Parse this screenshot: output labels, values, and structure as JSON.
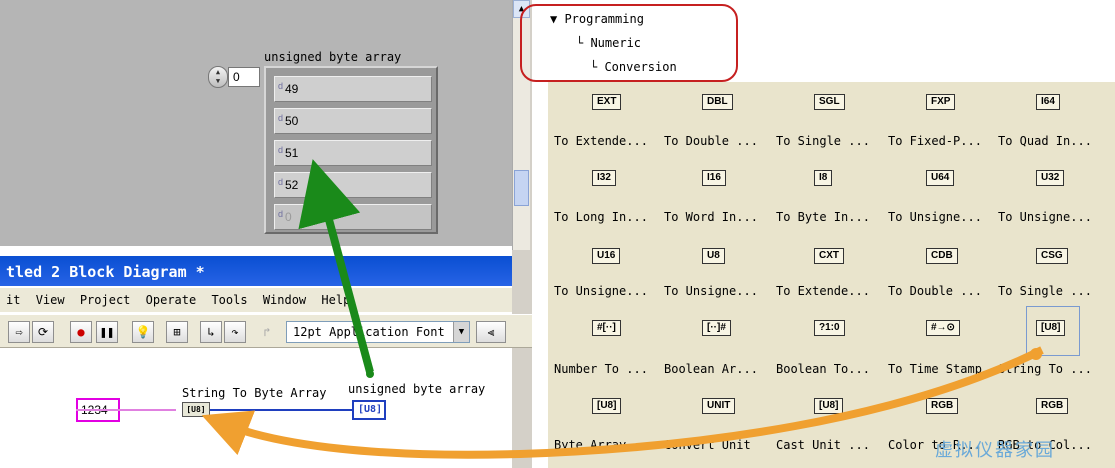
{
  "front_panel": {
    "array_label": "unsigned byte array",
    "index_value": "0",
    "radix": "d",
    "elements": [
      "49",
      "50",
      "51",
      "52",
      "0"
    ]
  },
  "block_diagram": {
    "window_title": "tled 2 Block Diagram *",
    "menu": [
      "it",
      "View",
      "Project",
      "Operate",
      "Tools",
      "Window",
      "Help"
    ],
    "font_selector": "12pt Application Font",
    "string_constant": "1234",
    "function_label": "String To Byte Array",
    "function_icon": "[U8]",
    "indicator_label": "unsigned byte array",
    "indicator_icon": "[U8]"
  },
  "palette": {
    "path": [
      "Programming",
      "Numeric",
      "Conversion"
    ],
    "rows": [
      {
        "icons": [
          "EXT",
          "DBL",
          "SGL",
          "FXP",
          "I64"
        ],
        "labels": [
          "To Extende...",
          "To Double ...",
          "To Single ...",
          "To Fixed-P...",
          "To Quad In..."
        ]
      },
      {
        "icons": [
          "I32",
          "I16",
          "I8",
          "U64",
          "U32"
        ],
        "labels": [
          "To Long In...",
          "To Word In...",
          "To Byte In...",
          "To Unsigne...",
          "To Unsigne..."
        ]
      },
      {
        "icons": [
          "U16",
          "U8",
          "CXT",
          "CDB",
          "CSG"
        ],
        "labels": [
          "To Unsigne...",
          "To Unsigne...",
          "To Extende...",
          "To Double ...",
          "To Single ..."
        ]
      },
      {
        "icons": [
          "#[··]",
          "[··]#",
          "?1:0",
          "#→⊙",
          "[U8]"
        ],
        "labels": [
          "Number To ...",
          "Boolean Ar...",
          "Boolean To...",
          "To Time Stamp",
          "String To ..."
        ]
      },
      {
        "icons": [
          "[U8]",
          "UNIT",
          "[U8]",
          "RGB",
          "RGB"
        ],
        "labels": [
          "Byte Array...",
          "Convert Unit",
          "Cast Unit ...",
          "Color to R...",
          "RGB to Col..."
        ]
      }
    ]
  },
  "watermark": "虚拟仪器家园",
  "colors": {
    "arrow_green": "#1a8a1a",
    "arrow_orange": "#f0a030",
    "highlight_red": "#c62020",
    "title_blue": "#0a4fd2"
  }
}
